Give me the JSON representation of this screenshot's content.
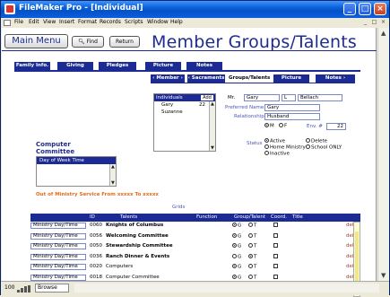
{
  "window": {
    "title": "FileMaker Pro - [Individual]",
    "minimize": "_",
    "maximize": "□",
    "close": "×"
  },
  "menu": [
    "File",
    "Edit",
    "View",
    "Insert",
    "Format",
    "Records",
    "Scripts",
    "Window",
    "Help"
  ],
  "mdi_controls": [
    "_",
    "□",
    "×"
  ],
  "header": {
    "main_menu": "Main Menu",
    "find": "Find",
    "return": "Return",
    "title": "Member Groups/Talents"
  },
  "top_tabs": [
    "Family Info.",
    "Giving",
    "Pledges",
    "Picture",
    "Notes"
  ],
  "sub_tabs": [
    "Member",
    "Sacraments",
    "Groups/Talents",
    "Picture",
    "Notes"
  ],
  "individuals": {
    "header": "Individuals",
    "add": "Add",
    "rows": [
      {
        "name": "Gary",
        "age": "22"
      },
      {
        "name": "Suzanne",
        "age": ""
      }
    ]
  },
  "person": {
    "prefix_label": "Mr.",
    "first": "Gary",
    "middle": "L",
    "last": "Bellach",
    "preferred_name_label": "Preferred Name",
    "preferred_name": "Gary",
    "relationship_label": "Relationship",
    "relationship": "Husband",
    "gender_m": "M",
    "gender_f": "F",
    "env_label": "Env. #",
    "env": "22"
  },
  "status": {
    "label": "Status",
    "options_left": [
      "Active",
      "Home Ministry",
      "Inactive"
    ],
    "options_right": [
      "Delete",
      "School ONLY"
    ]
  },
  "committee": {
    "title_line1": "Computer",
    "title_line2": "Committee",
    "column_header": "Day of Week  Time"
  },
  "warning": "Out of Ministry Service From xxxxx  To xxxxx",
  "grid": {
    "label": "Grids",
    "headers": [
      "ID",
      "Talents",
      "Function",
      "Group/Talent",
      "Coord.",
      "Title"
    ],
    "rows": [
      {
        "mdt": "Ministry Day/Time",
        "id": "0060",
        "talent": "Knights of Columbus",
        "g": true,
        "del": "del"
      },
      {
        "mdt": "Ministry Day/Time",
        "id": "0056",
        "talent": "Welcoming Committee",
        "g": true,
        "del": "del"
      },
      {
        "mdt": "Ministry Day/Time",
        "id": "0050",
        "talent": "Stewardship Committee",
        "g": true,
        "del": "del"
      },
      {
        "mdt": "Ministry Day/Time",
        "id": "0036",
        "talent": "Ranch Dinner & Events",
        "g": false,
        "del": "del"
      },
      {
        "mdt": "Ministry Day/Time",
        "id": "0020",
        "talent": "Computers",
        "g": true,
        "del": "del"
      },
      {
        "mdt": "Ministry Day/Time",
        "id": "0018",
        "talent": "Computer Committee",
        "g": true,
        "del": "del"
      },
      {
        "mdt": "Ministry Day/Time",
        "id": "",
        "talent": "",
        "g": false,
        "del": ""
      }
    ],
    "g_label": "G",
    "t_label": "T"
  },
  "statusbar": {
    "zoom": "100",
    "mode": "Browse"
  }
}
